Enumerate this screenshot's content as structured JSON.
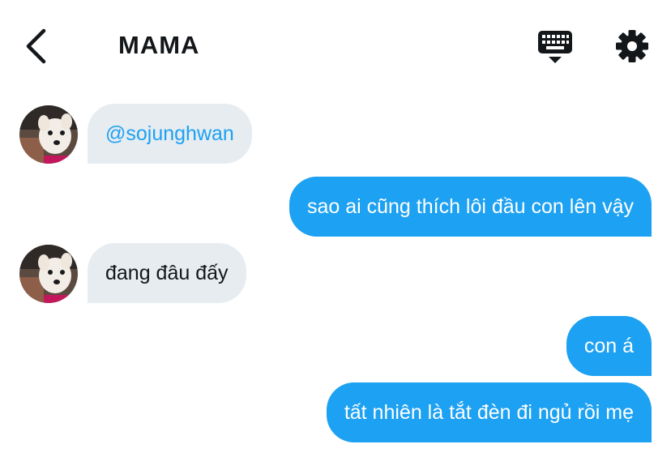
{
  "header": {
    "title": "MAMA",
    "back_icon": "chevron-left-icon",
    "keyboard_icon": "keyboard-icon",
    "settings_icon": "gear-icon"
  },
  "colors": {
    "outgoing_bubble": "#1da1f2",
    "incoming_bubble": "#e6ecf0",
    "mention": "#1da1f2",
    "text_dark": "#14171a"
  },
  "messages": [
    {
      "direction": "incoming",
      "text": "@sojunghwan",
      "is_mention": true
    },
    {
      "direction": "outgoing",
      "text": "sao ai cũng thích lôi đầu con lên vậy"
    },
    {
      "direction": "incoming",
      "text": "đang đâu đấy"
    },
    {
      "direction": "outgoing",
      "text": "con á"
    },
    {
      "direction": "outgoing",
      "text": "tất nhiên là tắt đèn đi ngủ rồi mẹ"
    }
  ]
}
